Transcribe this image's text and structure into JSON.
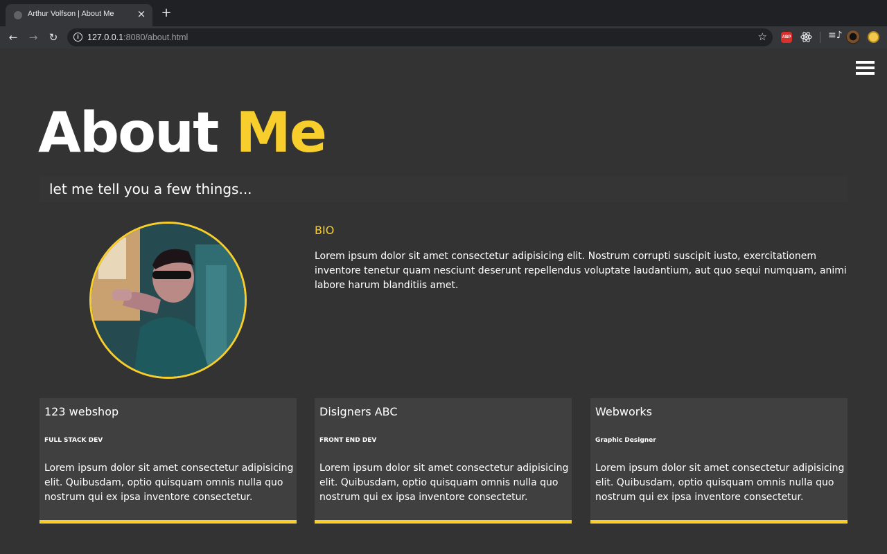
{
  "browser": {
    "tab_title": "Arthur Volfson | About Me",
    "tab_close": "×",
    "new_tab": "+",
    "url_host": "127.0.0.1",
    "url_path": ":8080/about.html",
    "icons": [
      "back-arrow-icon",
      "forward-arrow-icon",
      "reload-icon",
      "info-icon",
      "star-icon",
      "adblock-icon",
      "react-devtools-icon",
      "media-queue-icon",
      "extension-avatar-icon",
      "profile-icon"
    ],
    "abp_label": "ABP"
  },
  "page": {
    "heading_main": "About ",
    "heading_accent": "Me",
    "subtitle": "let me tell you a few things...",
    "bio": {
      "title": "BIO",
      "text": "Lorem ipsum dolor sit amet consectetur adipisicing elit. Nostrum corrupti suscipit iusto, exercitationem inventore tenetur quam nesciunt deserunt repellendus voluptate laudantium, aut quo sequi numquam, animi labore harum blanditiis amet."
    },
    "cards": [
      {
        "title": "123 webshop",
        "role": "FULL STACK DEV",
        "text": "Lorem ipsum dolor sit amet consectetur adipisicing elit. Quibusdam, optio quisquam omnis nulla quo nostrum qui ex ipsa inventore consectetur."
      },
      {
        "title": "Disigners ABC",
        "role": "FRONT END DEV",
        "text": "Lorem ipsum dolor sit amet consectetur adipisicing elit. Quibusdam, optio quisquam omnis nulla quo nostrum qui ex ipsa inventore consectetur."
      },
      {
        "title": "Webworks",
        "role": "Graphic Designer",
        "text": "Lorem ipsum dolor sit amet consectetur adipisicing elit. Quibusdam, optio quisquam omnis nulla quo nostrum qui ex ipsa inventore consectetur."
      }
    ]
  },
  "colors": {
    "accent": "#f7ce2b",
    "background": "#333333",
    "card": "#404040"
  }
}
